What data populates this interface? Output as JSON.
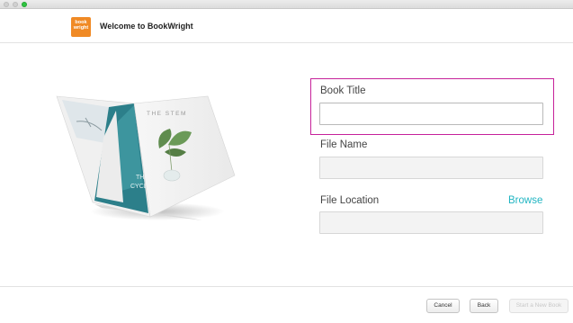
{
  "window": {
    "controls": [
      "close",
      "minimize",
      "zoom"
    ]
  },
  "header": {
    "logo_text_line1": "book",
    "logo_text_line2": "wright",
    "title": "Welcome to BookWright"
  },
  "illustration": {
    "left_page_text_1": "THE",
    "left_page_text_2": "CYCLE",
    "right_page_text": "THE STEM"
  },
  "form": {
    "book_title": {
      "label": "Book Title",
      "value": "",
      "placeholder": ""
    },
    "file_name": {
      "label": "File Name",
      "value": "",
      "placeholder": ""
    },
    "file_location": {
      "label": "File Location",
      "value": "",
      "placeholder": "",
      "browse_label": "Browse"
    }
  },
  "footer": {
    "cancel_label": "Cancel",
    "back_label": "Back",
    "start_label": "Start a New Book"
  },
  "colors": {
    "brand": "#f08a25",
    "accent": "#21b5c2",
    "focus_highlight": "#c6219a",
    "zoom_dot": "#2fc541"
  }
}
